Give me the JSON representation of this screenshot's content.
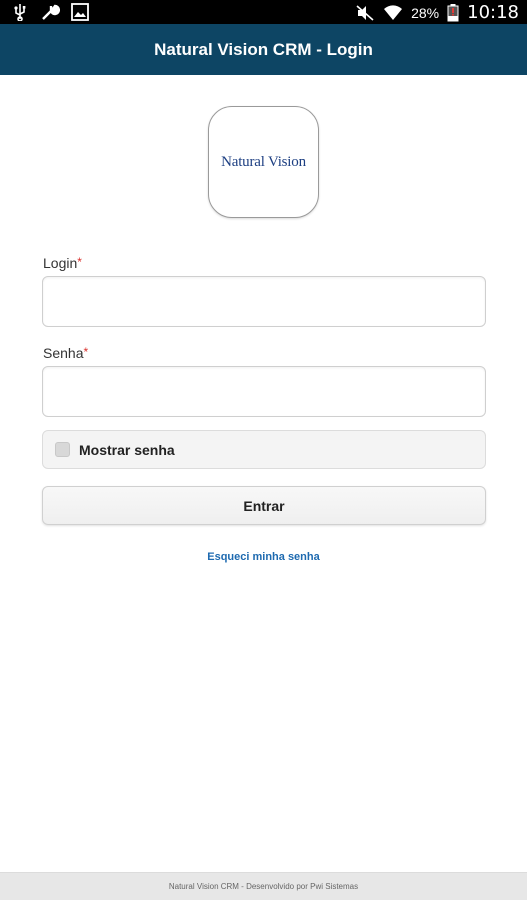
{
  "status_bar": {
    "battery": "28%",
    "time": "10:18",
    "icons": [
      "usb-icon",
      "wrench-icon",
      "image-icon",
      "mute-icon",
      "wifi-icon",
      "battery-icon"
    ]
  },
  "header": {
    "title": "Natural Vision CRM - Login"
  },
  "logo": {
    "text": "Natural Vision"
  },
  "form": {
    "login_label": "Login",
    "login_value": "",
    "senha_label": "Senha",
    "senha_value": "",
    "required_mark": "*",
    "show_password_label": "Mostrar senha",
    "show_password_checked": false,
    "submit_label": "Entrar",
    "forgot_link": "Esqueci minha senha"
  },
  "footer": {
    "text": "Natural Vision CRM - Desenvolvido por Pwi Sistemas"
  },
  "colors": {
    "header_bg": "#0d4564",
    "link": "#1e6ab0",
    "required": "#d9302c",
    "logo_text": "#1d3f82"
  }
}
